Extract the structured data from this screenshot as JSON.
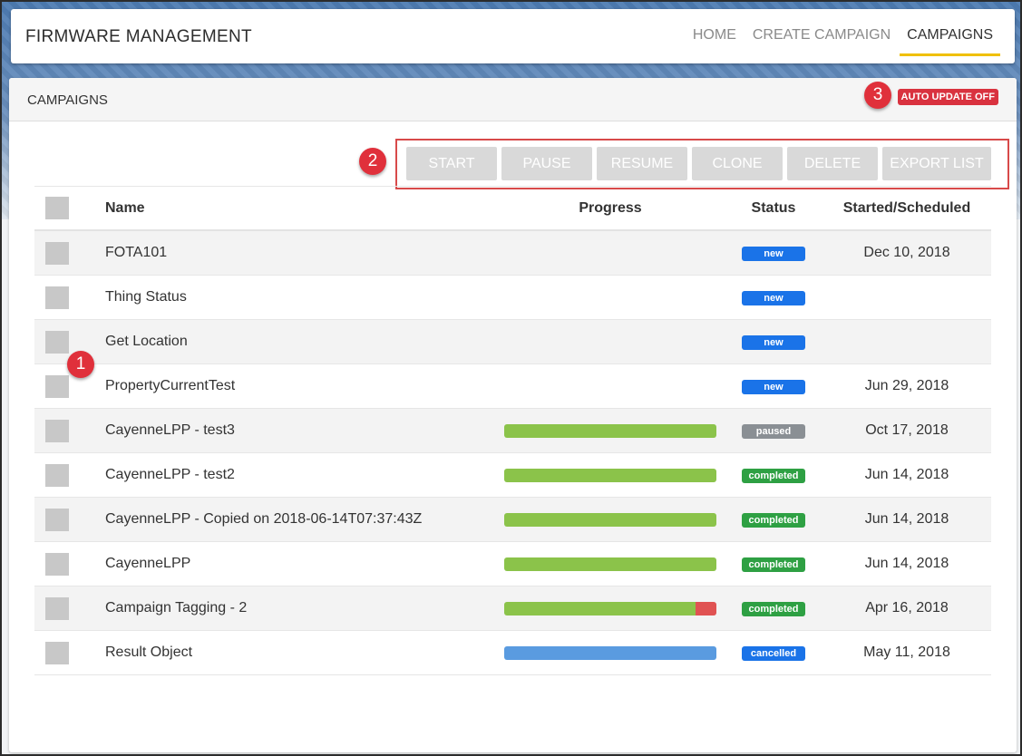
{
  "app": {
    "title": "FIRMWARE MANAGEMENT"
  },
  "nav": [
    {
      "label": "HOME",
      "active": false
    },
    {
      "label": "CREATE CAMPAIGN",
      "active": false
    },
    {
      "label": "CAMPAIGNS",
      "active": true
    }
  ],
  "panel": {
    "title": "CAMPAIGNS",
    "auto_update_label": "AUTO UPDATE OFF"
  },
  "callouts": [
    "1",
    "2",
    "3"
  ],
  "actions": [
    "START",
    "PAUSE",
    "RESUME",
    "CLONE",
    "DELETE",
    "EXPORT LIST"
  ],
  "table": {
    "headers": {
      "name": "Name",
      "progress": "Progress",
      "status": "Status",
      "date": "Started/Scheduled"
    },
    "rows": [
      {
        "name": "FOTA101",
        "progress": null,
        "status": "new",
        "date": "Dec 10, 2018"
      },
      {
        "name": "Thing Status",
        "progress": null,
        "status": "new",
        "date": ""
      },
      {
        "name": "Get Location",
        "progress": null,
        "status": "new",
        "date": ""
      },
      {
        "name": "PropertyCurrentTest",
        "progress": null,
        "status": "new",
        "date": "Jun 29, 2018"
      },
      {
        "name": "CayenneLPP - test3",
        "progress": {
          "success": 1.0,
          "failed": 0.0,
          "color": "#8bc34a"
        },
        "status": "paused",
        "date": "Oct 17, 2018"
      },
      {
        "name": "CayenneLPP - test2",
        "progress": {
          "success": 1.0,
          "failed": 0.0,
          "color": "#8bc34a"
        },
        "status": "completed",
        "date": "Jun 14, 2018"
      },
      {
        "name": "CayenneLPP - Copied on 2018-06-14T07:37:43Z",
        "progress": {
          "success": 1.0,
          "failed": 0.0,
          "color": "#8bc34a"
        },
        "status": "completed",
        "date": "Jun 14, 2018"
      },
      {
        "name": "CayenneLPP",
        "progress": {
          "success": 1.0,
          "failed": 0.0,
          "color": "#8bc34a"
        },
        "status": "completed",
        "date": "Jun 14, 2018"
      },
      {
        "name": "Campaign Tagging - 2",
        "progress": {
          "success": 0.9,
          "failed": 0.1,
          "color": "#8bc34a"
        },
        "status": "completed",
        "date": "Apr 16, 2018"
      },
      {
        "name": "Result Object",
        "progress": {
          "success": 1.0,
          "failed": 0.0,
          "color": "#5a9be0"
        },
        "status": "cancelled",
        "date": "May 11, 2018"
      }
    ]
  },
  "colors": {
    "new": "#1a73e8",
    "paused": "#8a8f94",
    "completed": "#2ea043",
    "cancelled": "#1a73e8",
    "failed": "#e05252",
    "accent": "#f0c000",
    "alert": "#d9323f"
  }
}
